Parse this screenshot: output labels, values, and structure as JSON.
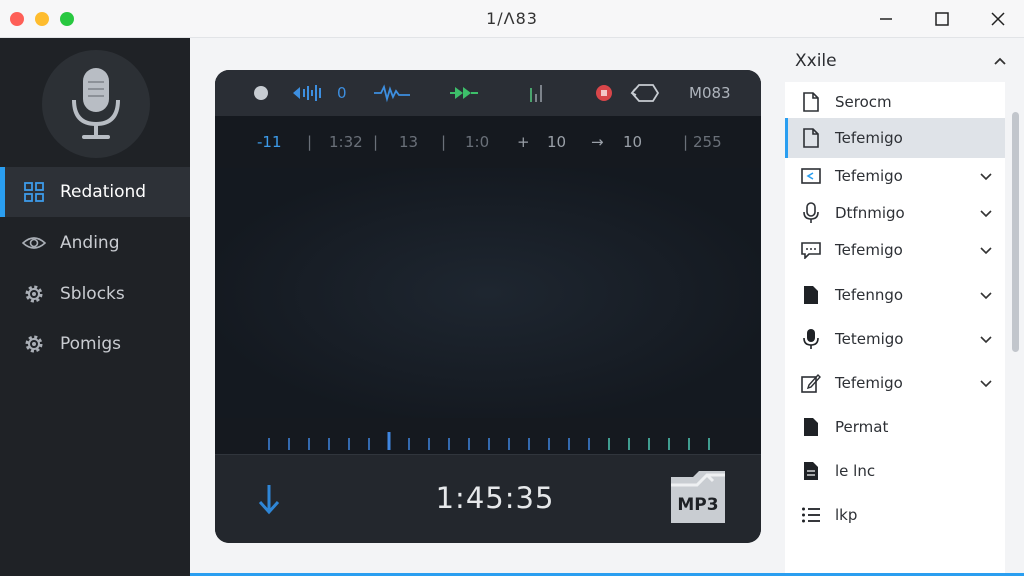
{
  "window": {
    "title": "1/Λ83",
    "controls": {
      "minimize": "minimize",
      "maximize": "maximize",
      "close": "close"
    }
  },
  "sidebar": {
    "items": [
      {
        "label": "Redationd",
        "icon": "grid-icon",
        "active": true
      },
      {
        "label": "Anding",
        "icon": "eye-icon",
        "active": false
      },
      {
        "label": "Sblocks",
        "icon": "gear-icon",
        "active": false
      },
      {
        "label": "Pomigs",
        "icon": "gear-icon",
        "active": false
      }
    ]
  },
  "player": {
    "toolbar": {
      "level_value": "0",
      "format": "M083"
    },
    "ruler": {
      "labels": [
        "-11",
        "1:32",
        "13",
        "1:0",
        "10",
        "10",
        "255"
      ]
    },
    "time": "1:45:35",
    "format_badge": "MP3",
    "colors": {
      "wave_start": "#3f86e0",
      "wave_end": "#4fd6c2",
      "accent": "#2a9ef0"
    }
  },
  "rpanel": {
    "title": "Xxile",
    "items": [
      {
        "label": "Serocm",
        "icon": "document-icon",
        "chevron": false,
        "selected": false
      },
      {
        "label": "Tefemigo",
        "icon": "document-icon",
        "chevron": false,
        "selected": true
      },
      {
        "label": "Tefemigo",
        "icon": "import-icon",
        "chevron": true,
        "selected": false
      },
      {
        "label": "Dtfnmigo",
        "icon": "microphone-icon",
        "chevron": true,
        "selected": false
      },
      {
        "label": "Tefemigo",
        "icon": "comment-icon",
        "chevron": true,
        "selected": false
      },
      {
        "label": "Tefenngo",
        "icon": "file-filled-icon",
        "chevron": true,
        "selected": false
      },
      {
        "label": "Tetemigo",
        "icon": "microphone-filled-icon",
        "chevron": true,
        "selected": false
      },
      {
        "label": "Tefemigo",
        "icon": "edit-icon",
        "chevron": true,
        "selected": false
      },
      {
        "label": "Permat",
        "icon": "file-filled-icon",
        "chevron": false,
        "selected": false
      },
      {
        "label": "le lnc",
        "icon": "file-lines-icon",
        "chevron": false,
        "selected": false
      },
      {
        "label": "lkp",
        "icon": "list-icon",
        "chevron": false,
        "selected": false
      }
    ]
  }
}
